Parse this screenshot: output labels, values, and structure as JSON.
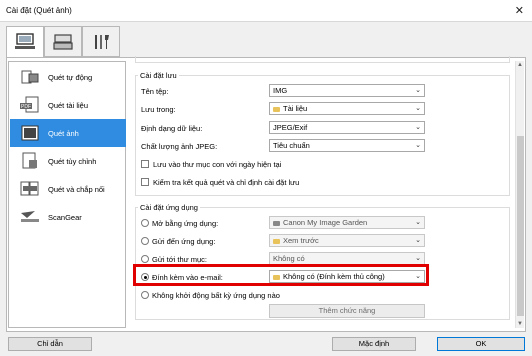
{
  "window": {
    "title": "Cài đặt (Quét ảnh)",
    "close_glyph": "✕"
  },
  "tabs": [
    {
      "icon": "scan-from-computer-icon"
    },
    {
      "icon": "scan-from-panel-icon"
    },
    {
      "icon": "tools-icon"
    }
  ],
  "sidebar": {
    "items": [
      {
        "label": "Quét tự động",
        "icon": "auto-scan-icon"
      },
      {
        "label": "Quét tài liệu",
        "icon": "document-scan-icon",
        "badge": "PDF"
      },
      {
        "label": "Quét ảnh",
        "icon": "photo-scan-icon",
        "selected": true
      },
      {
        "label": "Quét tùy chỉnh",
        "icon": "custom-scan-icon"
      },
      {
        "label": "Quét và chắp nối",
        "icon": "stitch-scan-icon"
      },
      {
        "label": "ScanGear",
        "icon": "scangear-icon"
      }
    ]
  },
  "save_settings": {
    "group_title": "Cài đặt lưu",
    "file_name_label": "Tên tệp:",
    "file_name_value": "IMG",
    "save_in_label": "Lưu trong:",
    "save_in_value": "Tài liệu",
    "data_format_label": "Định dạng dữ liệu:",
    "data_format_value": "JPEG/Exif",
    "jpeg_quality_label": "Chất lượng ảnh JPEG:",
    "jpeg_quality_value": "Tiêu chuẩn",
    "subfolder_checkbox": "Lưu vào thư mục con với ngày hiện tại",
    "check_result_checkbox": "Kiểm tra kết quả quét và chỉ định cài đặt lưu"
  },
  "app_settings": {
    "group_title": "Cài đặt ứng dụng",
    "open_app_label": "Mở bằng ứng dụng:",
    "open_app_value": "Canon My Image Garden",
    "send_app_label": "Gửi đến ứng dụng:",
    "send_app_value": "Xem trước",
    "send_folder_label": "Gửi tới thư mục:",
    "send_folder_value": "Không có",
    "attach_email_label": "Đính kèm vào e-mail:",
    "attach_email_value": "Không có (Đính kèm thủ công)",
    "no_app_label": "Không khởi động bất kỳ ứng dụng nào",
    "more_functions_button": "Thêm chức năng"
  },
  "footer": {
    "help_button": "Chỉ dẫn",
    "defaults_button": "Mặc định",
    "ok_button": "OK"
  },
  "colors": {
    "selection": "#2f8ce0",
    "highlight": "#e00000"
  }
}
